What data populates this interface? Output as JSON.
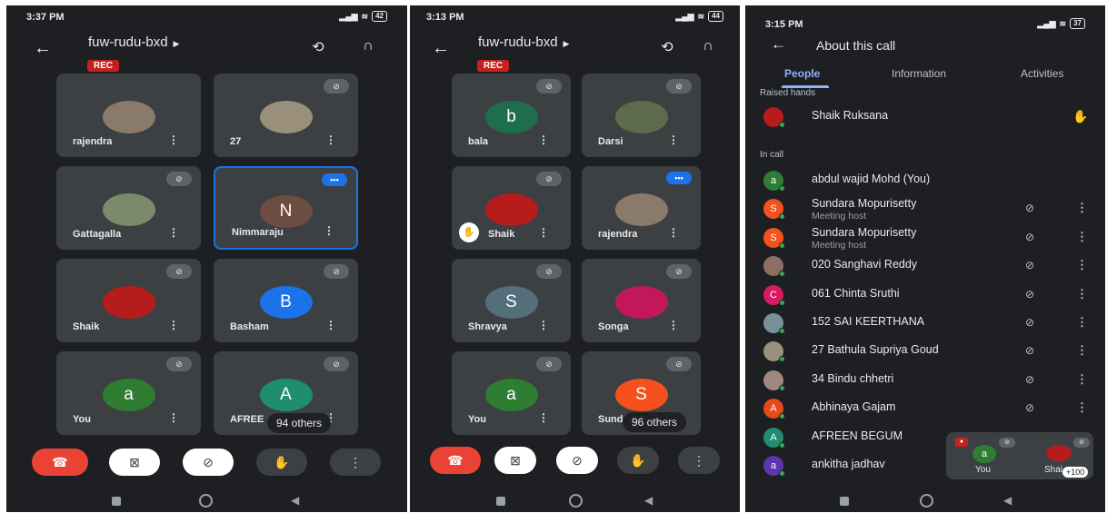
{
  "screen1": {
    "time": "3:37 PM",
    "battery": "42",
    "meeting_code": "fuw-rudu-bxd",
    "rec_label": "REC",
    "tiles": [
      {
        "name": "rajendra",
        "initial": "",
        "color": "#8a7a6a",
        "muted": false
      },
      {
        "name": "27",
        "initial": "",
        "color": "#9a8f7a",
        "muted": true
      },
      {
        "name": "Gattagalla",
        "initial": "",
        "color": "#7b8a6a",
        "muted": true
      },
      {
        "name": "Nimmaraju",
        "initial": "N",
        "color": "#6d4c41",
        "muted": false,
        "speaking": true
      },
      {
        "name": "Shaik",
        "initial": "",
        "color": "#b71c1c",
        "muted": true
      },
      {
        "name": "Basham",
        "initial": "B",
        "color": "#1a73e8",
        "muted": true
      },
      {
        "name": "You",
        "initial": "a",
        "color": "#2e7d32",
        "muted": true
      },
      {
        "name": "AFREE",
        "initial": "A",
        "color": "#1e8e6e",
        "muted": true
      }
    ],
    "others_label": "94 others"
  },
  "screen2": {
    "time": "3:13 PM",
    "battery": "44",
    "meeting_code": "fuw-rudu-bxd",
    "rec_label": "REC",
    "tiles": [
      {
        "name": "bala",
        "initial": "b",
        "color": "#1e6e4e",
        "muted": true
      },
      {
        "name": "Darsi",
        "initial": "",
        "color": "#5d6b4a",
        "muted": true
      },
      {
        "name": "Shaik",
        "initial": "",
        "color": "#b71c1c",
        "muted": true,
        "hand": true
      },
      {
        "name": "rajendra",
        "initial": "",
        "color": "#8a7a6a",
        "muted": false,
        "speaking": true
      },
      {
        "name": "Shravya",
        "initial": "S",
        "color": "#546e7a",
        "muted": true
      },
      {
        "name": "Songa",
        "initial": "",
        "color": "#c2185b",
        "muted": true
      },
      {
        "name": "You",
        "initial": "a",
        "color": "#2e7d32",
        "muted": true
      },
      {
        "name": "Sunda",
        "initial": "S",
        "color": "#f4511e",
        "muted": true
      }
    ],
    "others_label": "96 others"
  },
  "screen3": {
    "time": "3:15 PM",
    "battery": "37",
    "title": "About this call",
    "tabs": [
      "People",
      "Information",
      "Activities"
    ],
    "raised_hands_label": "Raised hands",
    "raised": {
      "name": "Shaik Ruksana",
      "color": "#b71c1c"
    },
    "in_call_label": "In call",
    "people": [
      {
        "name": "abdul wajid Mohd (You)",
        "initial": "a",
        "color": "#2e7d32",
        "role": "",
        "actions": false
      },
      {
        "name": "Sundara Mopurisetty",
        "initial": "S",
        "color": "#f4511e",
        "role": "Meeting host",
        "actions": true
      },
      {
        "name": "Sundara Mopurisetty",
        "initial": "S",
        "color": "#f4511e",
        "role": "Meeting host",
        "actions": true
      },
      {
        "name": "020 Sanghavi Reddy",
        "initial": "",
        "color": "#8d6e63",
        "role": "",
        "actions": true
      },
      {
        "name": "061 Chinta Sruthi",
        "initial": "C",
        "color": "#d81b60",
        "role": "",
        "actions": true
      },
      {
        "name": "152 SAI KEERTHANA",
        "initial": "",
        "color": "#78909c",
        "role": "",
        "actions": true
      },
      {
        "name": "27 Bathula Supriya Goud",
        "initial": "",
        "color": "#9a8f7a",
        "role": "",
        "actions": true
      },
      {
        "name": "34 Bindu chhetri",
        "initial": "",
        "color": "#a1887f",
        "role": "",
        "actions": true
      },
      {
        "name": "Abhinaya Gajam",
        "initial": "A",
        "color": "#e64a19",
        "role": "",
        "actions": true
      },
      {
        "name": "AFREEN BEGUM",
        "initial": "A",
        "color": "#1e8e6e",
        "role": "",
        "actions": false
      },
      {
        "name": "ankitha jadhav",
        "initial": "a",
        "color": "#5e35b1",
        "role": "",
        "actions": false
      }
    ],
    "pip": {
      "you_label": "You",
      "you_initial": "a",
      "other_label": "Shai",
      "count": "+100"
    }
  }
}
